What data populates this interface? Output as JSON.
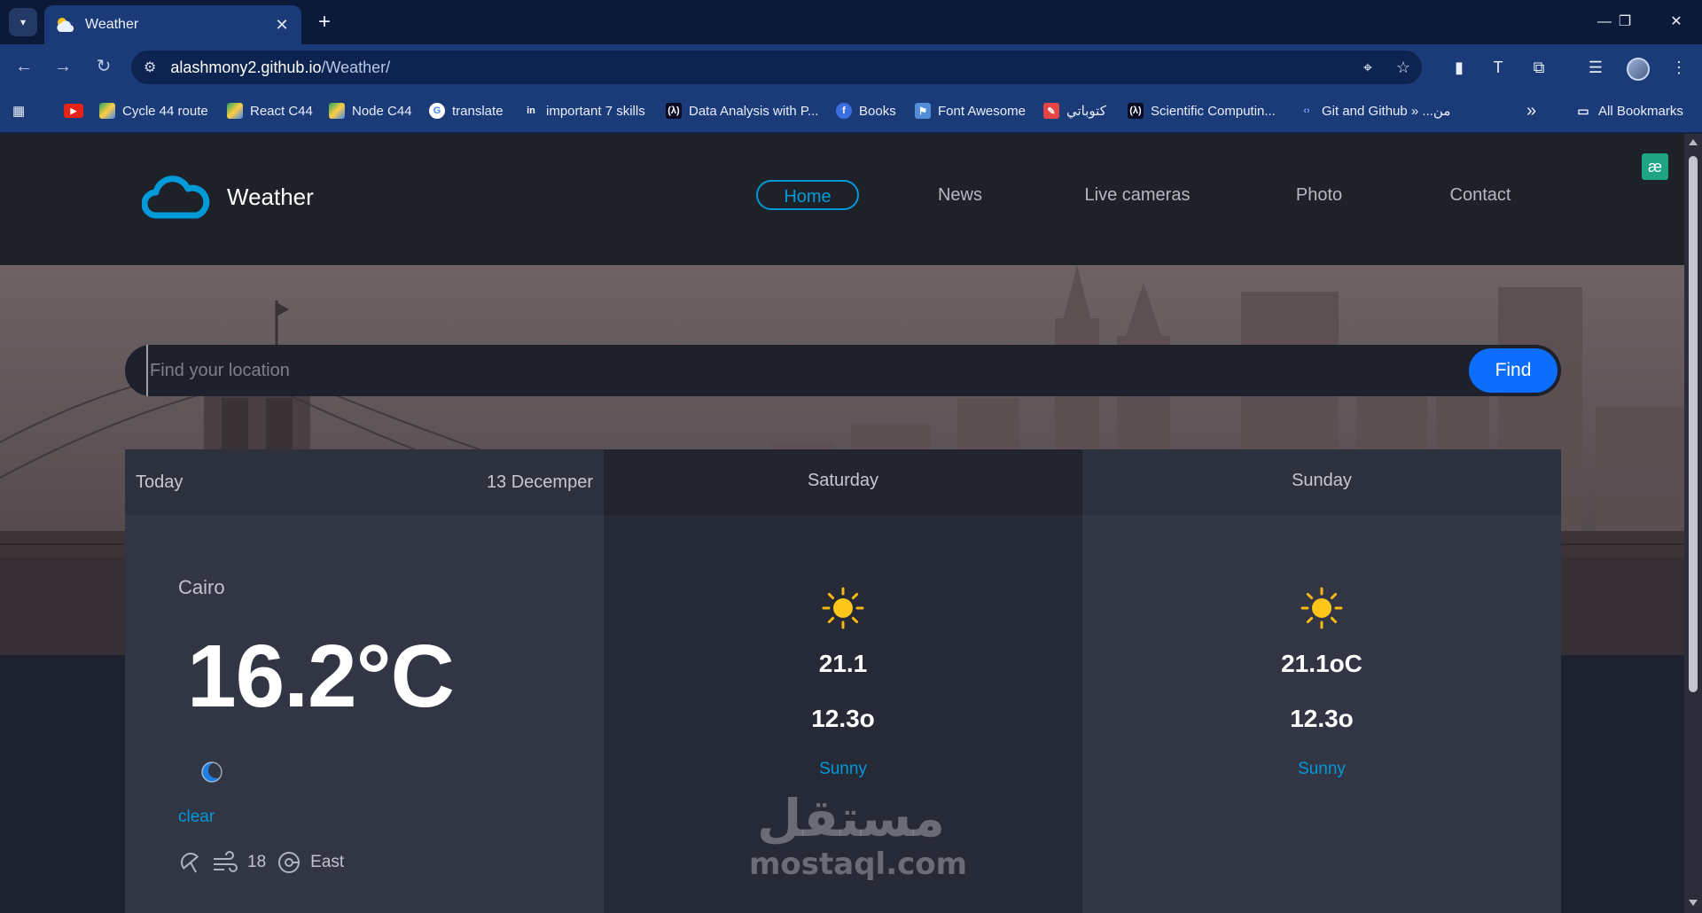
{
  "browser": {
    "tab": {
      "title": "Weather"
    },
    "new_tab": "+",
    "window_controls": {
      "minimize": "—",
      "restore": "❐",
      "close": "✕"
    },
    "address": {
      "host": "alashmony2.github.io",
      "path": "/Weather/"
    },
    "bookmarks": [
      {
        "label": "Cycle 44 route",
        "icon": "drive-icon"
      },
      {
        "label": "React C44",
        "icon": "drive-icon"
      },
      {
        "label": "Node C44",
        "icon": "drive-icon"
      },
      {
        "label": "translate",
        "icon": "google-icon"
      },
      {
        "label": "important 7 skills",
        "icon": "linkedin-icon"
      },
      {
        "label": "Data Analysis with P...",
        "icon": "freecodecamp-icon"
      },
      {
        "label": "Books",
        "icon": "f-icon"
      },
      {
        "label": "Font Awesome",
        "icon": "flag-icon"
      },
      {
        "label": "كتوباتي",
        "icon": "kotobati-icon"
      },
      {
        "label": "Scientific Computin...",
        "icon": "freecodecamp-icon"
      },
      {
        "label": "Git and Github » ...من",
        "icon": "code-icon"
      }
    ],
    "all_bookmarks": "All Bookmarks",
    "more_bookmarks": "»"
  },
  "site": {
    "brand": "Weather",
    "nav": [
      "Home",
      "News",
      "Live cameras",
      "Photo",
      "Contact"
    ],
    "active_nav": "Home",
    "search": {
      "placeholder": "Find your location",
      "button": "Find"
    },
    "today": {
      "day": "Today",
      "date": "13 Decemper",
      "city": "Cairo",
      "temp": "16.2°C",
      "condition": "clear",
      "wind_speed": "18",
      "wind_dir": "East"
    },
    "forecast": [
      {
        "day": "Saturday",
        "max": "21.1",
        "min": "12.3o",
        "condition": "Sunny"
      },
      {
        "day": "Sunday",
        "max": "21.1oC",
        "min": "12.3o",
        "condition": "Sunny"
      }
    ]
  },
  "watermark": {
    "arabic": "مستقل",
    "latin": "mostaql.com"
  },
  "colors": {
    "accent": "#009ad8",
    "find_button": "#0d6efd",
    "chrome": "#1b3a78"
  }
}
